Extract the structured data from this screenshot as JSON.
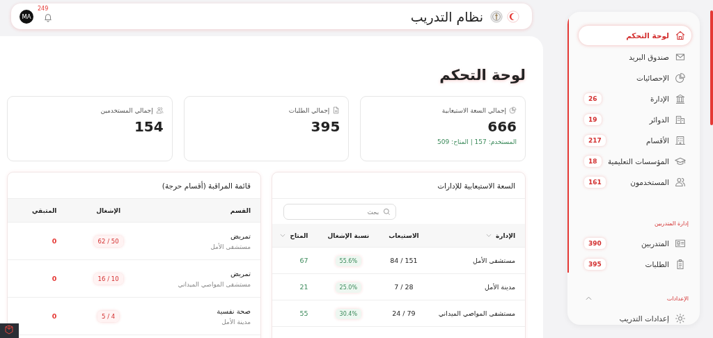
{
  "header": {
    "title": "نظام التدريب",
    "notifications": "249",
    "avatar": "MA"
  },
  "sidebar": {
    "groups": [
      {
        "items": [
          {
            "label": "لوحة التحكم",
            "selected": true
          },
          {
            "label": "صندوق البريد",
            "selected": false
          },
          {
            "label": "الإحصائيات",
            "selected": false
          },
          {
            "label": "الإدارة",
            "badge": "26",
            "selected": false
          },
          {
            "label": "الدوائر",
            "badge": "19",
            "selected": false
          },
          {
            "label": "الأقسام",
            "badge": "217",
            "selected": false
          },
          {
            "label": "المؤسسات التعليمية",
            "badge": "18",
            "selected": false
          },
          {
            "label": "المستخدمون",
            "badge": "161",
            "selected": false
          }
        ]
      },
      {
        "heading": "إدارة المتدربين",
        "items": [
          {
            "label": "المتدربين",
            "badge": "390",
            "selected": false
          },
          {
            "label": "الطلبات",
            "badge": "395",
            "selected": false
          }
        ]
      },
      {
        "heading": "الإعدادات",
        "expanded": true,
        "items": [
          {
            "label": "إعدادات التدريب",
            "selected": false
          }
        ]
      }
    ]
  },
  "page_title": "لوحة التحكم",
  "stats": [
    {
      "label": "إجمالي السعة الاستيعابية",
      "value": "666",
      "note": "المستخدم: 157 | المتاح: 509"
    },
    {
      "label": "إجمالي الطلبات",
      "value": "395"
    },
    {
      "label": "إجمالي المستخدمين",
      "value": "154"
    }
  ],
  "capacity": {
    "title": "السعة الاستيعابية للإدارات",
    "search": {
      "placeholder": "بحث"
    },
    "columns": [
      {
        "label": "الإدارة",
        "sortable": true
      },
      {
        "label": "الاستيعاب",
        "sortable": false
      },
      {
        "label": "نسبة الإشغال",
        "sortable": false
      },
      {
        "label": "المتاح",
        "sortable": true
      }
    ],
    "rows": [
      {
        "name": "مستشفى الأمل",
        "capacity": "151 / 84",
        "rate": "55.6%",
        "available": "67"
      },
      {
        "name": "مدينة الأمل",
        "capacity": "28 / 7",
        "rate": "25.0%",
        "available": "21"
      },
      {
        "name": "مستشفى المواصي الميداني",
        "capacity": "79 / 24",
        "rate": "30.4%",
        "available": "55"
      }
    ]
  },
  "watchlist": {
    "title": "قائمة المراقبة (أقسام حرجة)",
    "columns": [
      "القسم",
      "الإشغال",
      "المتبقي"
    ],
    "rows": [
      {
        "section": "تمريض",
        "place": "مستشفى الأمل",
        "occupancy": "50 / 62",
        "remaining": "0"
      },
      {
        "section": "تمريض",
        "place": "مستشفى المواصي الميداني",
        "occupancy": "10 / 16",
        "remaining": "0"
      },
      {
        "section": "صحة نفسية",
        "place": "مدينة الأمل",
        "occupancy": "4 / 5",
        "remaining": "0"
      }
    ]
  }
}
